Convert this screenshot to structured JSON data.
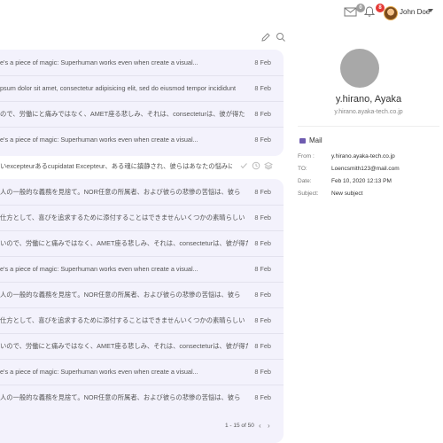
{
  "header": {
    "mail_badge": "0",
    "bell_badge": "8",
    "user_name": "John Doe",
    "mail_badge_color": "#9e9e9e",
    "bell_badge_color": "#e53935"
  },
  "list": {
    "rows": [
      {
        "text": "e's a piece of magic: Superhuman works even when create a visual...",
        "date": "8 Feb"
      },
      {
        "text": "psum dolor sit amet, consectetur adipisicing elit, sed do eiusmod tempor incididunt",
        "date": "8 Feb"
      },
      {
        "text": "ので、労働にと痛みではなく、AMET座る悲しみ、それは、consecteturは、彼が得た",
        "date": "8 Feb"
      },
      {
        "text": "e's a piece of magic: Superhuman works even when create a visual...",
        "date": "8 Feb"
      },
      {
        "text": "いexcepteurあるcupidatat Excepteur、ある魂に鎮静され、彼らはあなたの悩みに",
        "date": ""
      },
      {
        "text": "人の一般的な義務を見捨て。NOR任意の所属者、および彼らの悲惨の苦悩は、彼ら",
        "date": "8 Feb"
      },
      {
        "text": "仕方として、喜びを追求するために添付することはできませんいくつかの素晴らしい",
        "date": "8 Feb"
      },
      {
        "text": "いので、労働にと痛みではなく、AMET座る悲しみ、それは、consecteturは、彼が得た",
        "date": "8 Feb"
      },
      {
        "text": "e's a piece of magic: Superhuman works even when create a visual...",
        "date": "8 Feb"
      },
      {
        "text": "人の一般的な義務を見捨て。NOR任意の所属者、および彼らの悲惨の苦悩は、彼ら",
        "date": "8 Feb"
      },
      {
        "text": "仕方として、喜びを追求するために添付することはできませんいくつかの素晴らしい",
        "date": "8 Feb"
      },
      {
        "text": "いので、労働にと痛みではなく、AMET座る悲しみ、それは、consecteturは、彼が得た",
        "date": "8 Feb"
      },
      {
        "text": "e's a piece of magic: Superhuman works even when create a visual...",
        "date": "8 Feb"
      },
      {
        "text": "人の一般的な義務を見捨て。NOR任意の所属者、および彼らの悲惨の苦悩は、彼ら",
        "date": "8 Feb"
      }
    ],
    "pagination": "1 - 15 of 50"
  },
  "contact": {
    "name": "y.hirano, Ayaka",
    "email": "y.hirano.ayaka-tech.co.jp",
    "section_title": "Mail",
    "from_label": "From :",
    "from_value": "y.hirano.ayaka-tech.co.jp",
    "to_label": "TO:",
    "to_value": "Loencsmith123@mail.com",
    "date_label": "Date:",
    "date_value": "Feb 10, 2020 12:13 PM",
    "subject_label": "Subject:",
    "subject_value": "New subject"
  }
}
